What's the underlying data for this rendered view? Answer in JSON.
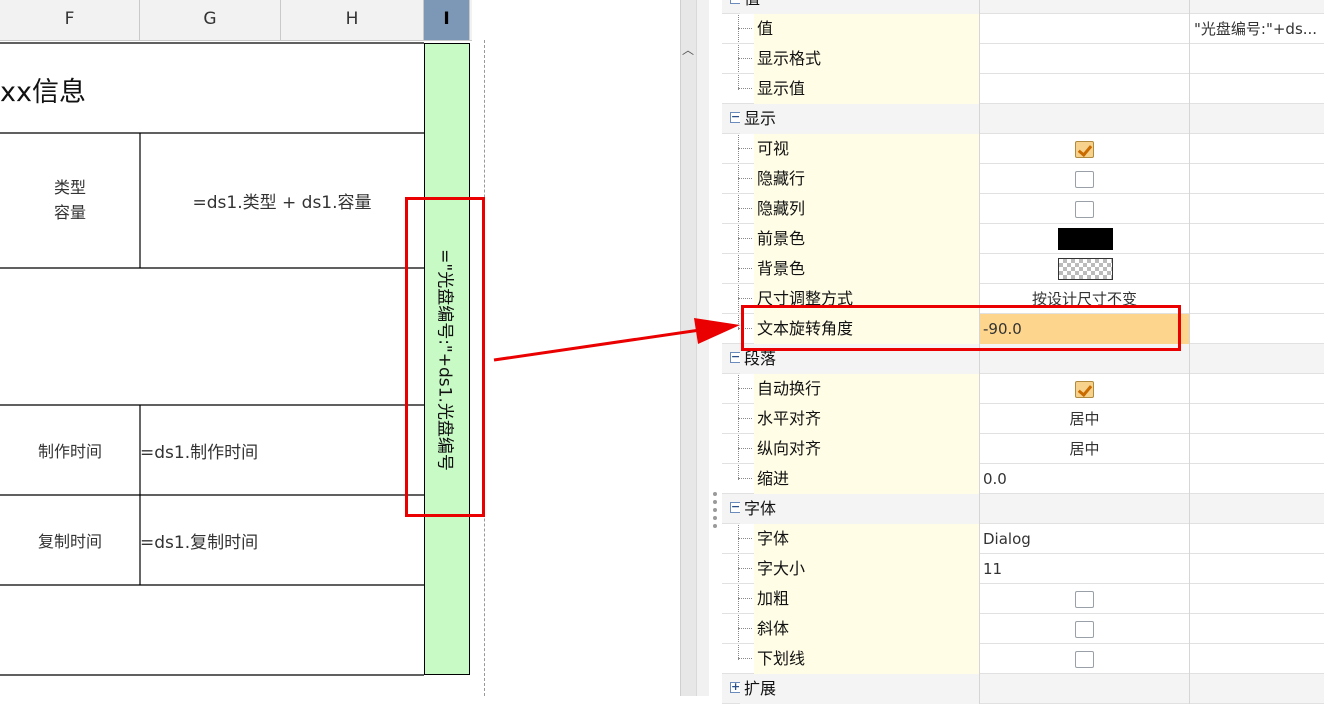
{
  "columns": [
    {
      "label": "F",
      "selected": false
    },
    {
      "label": "G",
      "selected": false
    },
    {
      "label": "H",
      "selected": false
    },
    {
      "label": "I",
      "selected": true
    }
  ],
  "report": {
    "title": "xx信息",
    "type_capacity_label_line1": "类型",
    "type_capacity_label_line2": "容量",
    "type_capacity_value": "=ds1.类型 + ds1.容量",
    "made_time_label": "制作时间",
    "made_time_value": "=ds1.制作时间",
    "copy_time_label": "复制时间",
    "copy_time_value": "=ds1.复制时间",
    "rotated_formula": "=\"光盘编号:\"+ds1.光盘编号"
  },
  "properties": {
    "top_group": "值",
    "rows": [
      {
        "label": "值",
        "value": "",
        "value2": "\"光盘编号:\"+ds..."
      },
      {
        "label": "显示格式",
        "value": ""
      },
      {
        "label": "显示值",
        "value": ""
      }
    ],
    "display_group": "显示",
    "display": {
      "visible_label": "可视",
      "visible_checked": true,
      "hide_row_label": "隐藏行",
      "hide_row_checked": false,
      "hide_col_label": "隐藏列",
      "hide_col_checked": false,
      "foreground_label": "前景色",
      "foreground_color": "#000000",
      "background_label": "背景色",
      "background_color": "transparent",
      "size_mode_label": "尺寸调整方式",
      "size_mode_value": "按设计尺寸不变",
      "rotation_label": "文本旋转角度",
      "rotation_value": "-90.0"
    },
    "paragraph_group": "段落",
    "paragraph": {
      "wrap_label": "自动换行",
      "wrap_checked": true,
      "halign_label": "水平对齐",
      "halign_value": "居中",
      "valign_label": "纵向对齐",
      "valign_value": "居中",
      "indent_label": "缩进",
      "indent_value": "0.0"
    },
    "font_group": "字体",
    "font": {
      "family_label": "字体",
      "family_value": "Dialog",
      "size_label": "字大小",
      "size_value": "11",
      "bold_label": "加粗",
      "bold_checked": false,
      "italic_label": "斜体",
      "italic_checked": false,
      "underline_label": "下划线",
      "underline_checked": false
    },
    "extend_group": "扩展"
  },
  "icons": {
    "scroll_up": "chevron-up-icon",
    "expand": "plus-box-icon",
    "collapse": "minus-box-icon"
  }
}
